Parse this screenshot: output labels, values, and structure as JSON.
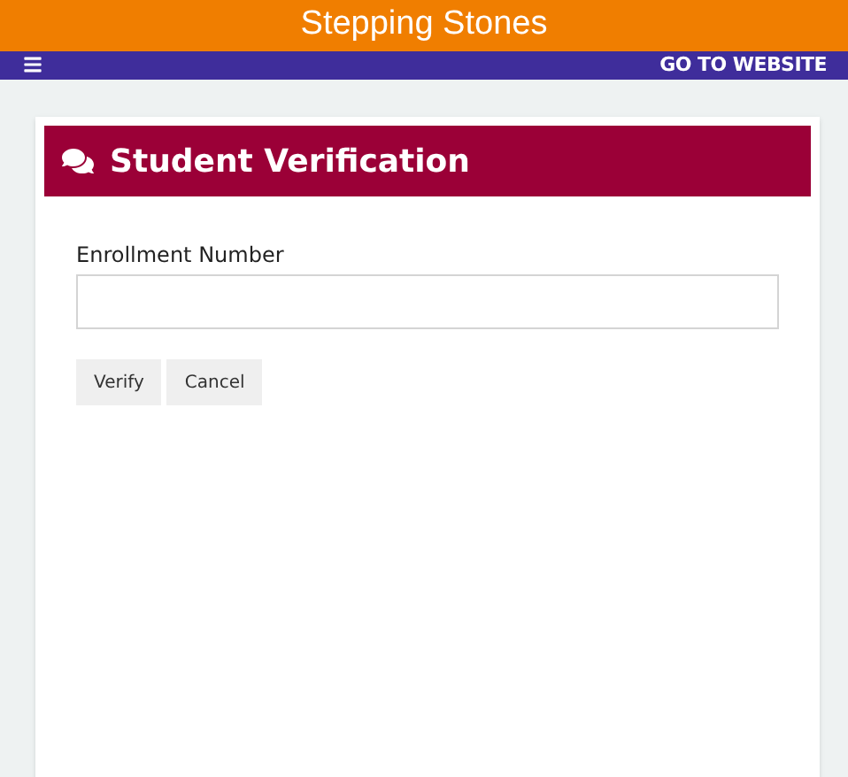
{
  "header": {
    "title": "Stepping Stones"
  },
  "navbar": {
    "link": "GO TO WEBSITE"
  },
  "card": {
    "title": "Student Verification",
    "field": {
      "label": "Enrollment Number"
    },
    "buttons": [
      "Verify",
      "Cancel"
    ]
  }
}
